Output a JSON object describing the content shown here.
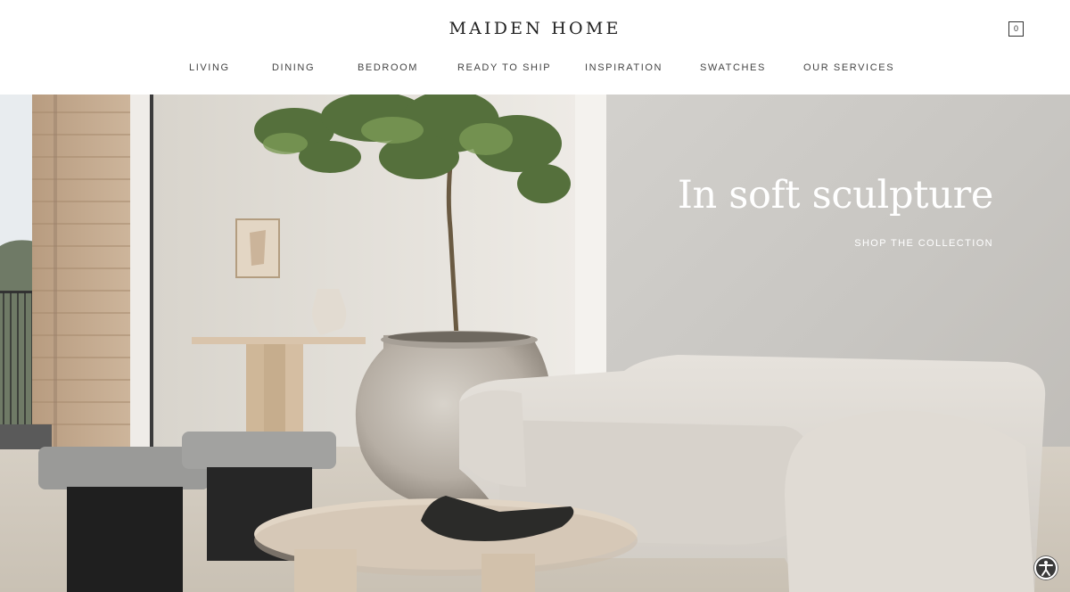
{
  "header": {
    "logo": "MAIDEN HOME",
    "cart_count": "0",
    "nav": [
      {
        "label": "LIVING"
      },
      {
        "label": "DINING"
      },
      {
        "label": "BEDROOM"
      },
      {
        "label": "READY TO SHIP"
      },
      {
        "label": "INSPIRATION"
      },
      {
        "label": "SWATCHES"
      },
      {
        "label": "OUR SERVICES"
      }
    ]
  },
  "hero": {
    "headline": "In soft sculpture",
    "cta": "SHOP THE COLLECTION"
  },
  "icons": {
    "cart": "cart-icon",
    "accessibility": "accessibility-icon"
  }
}
